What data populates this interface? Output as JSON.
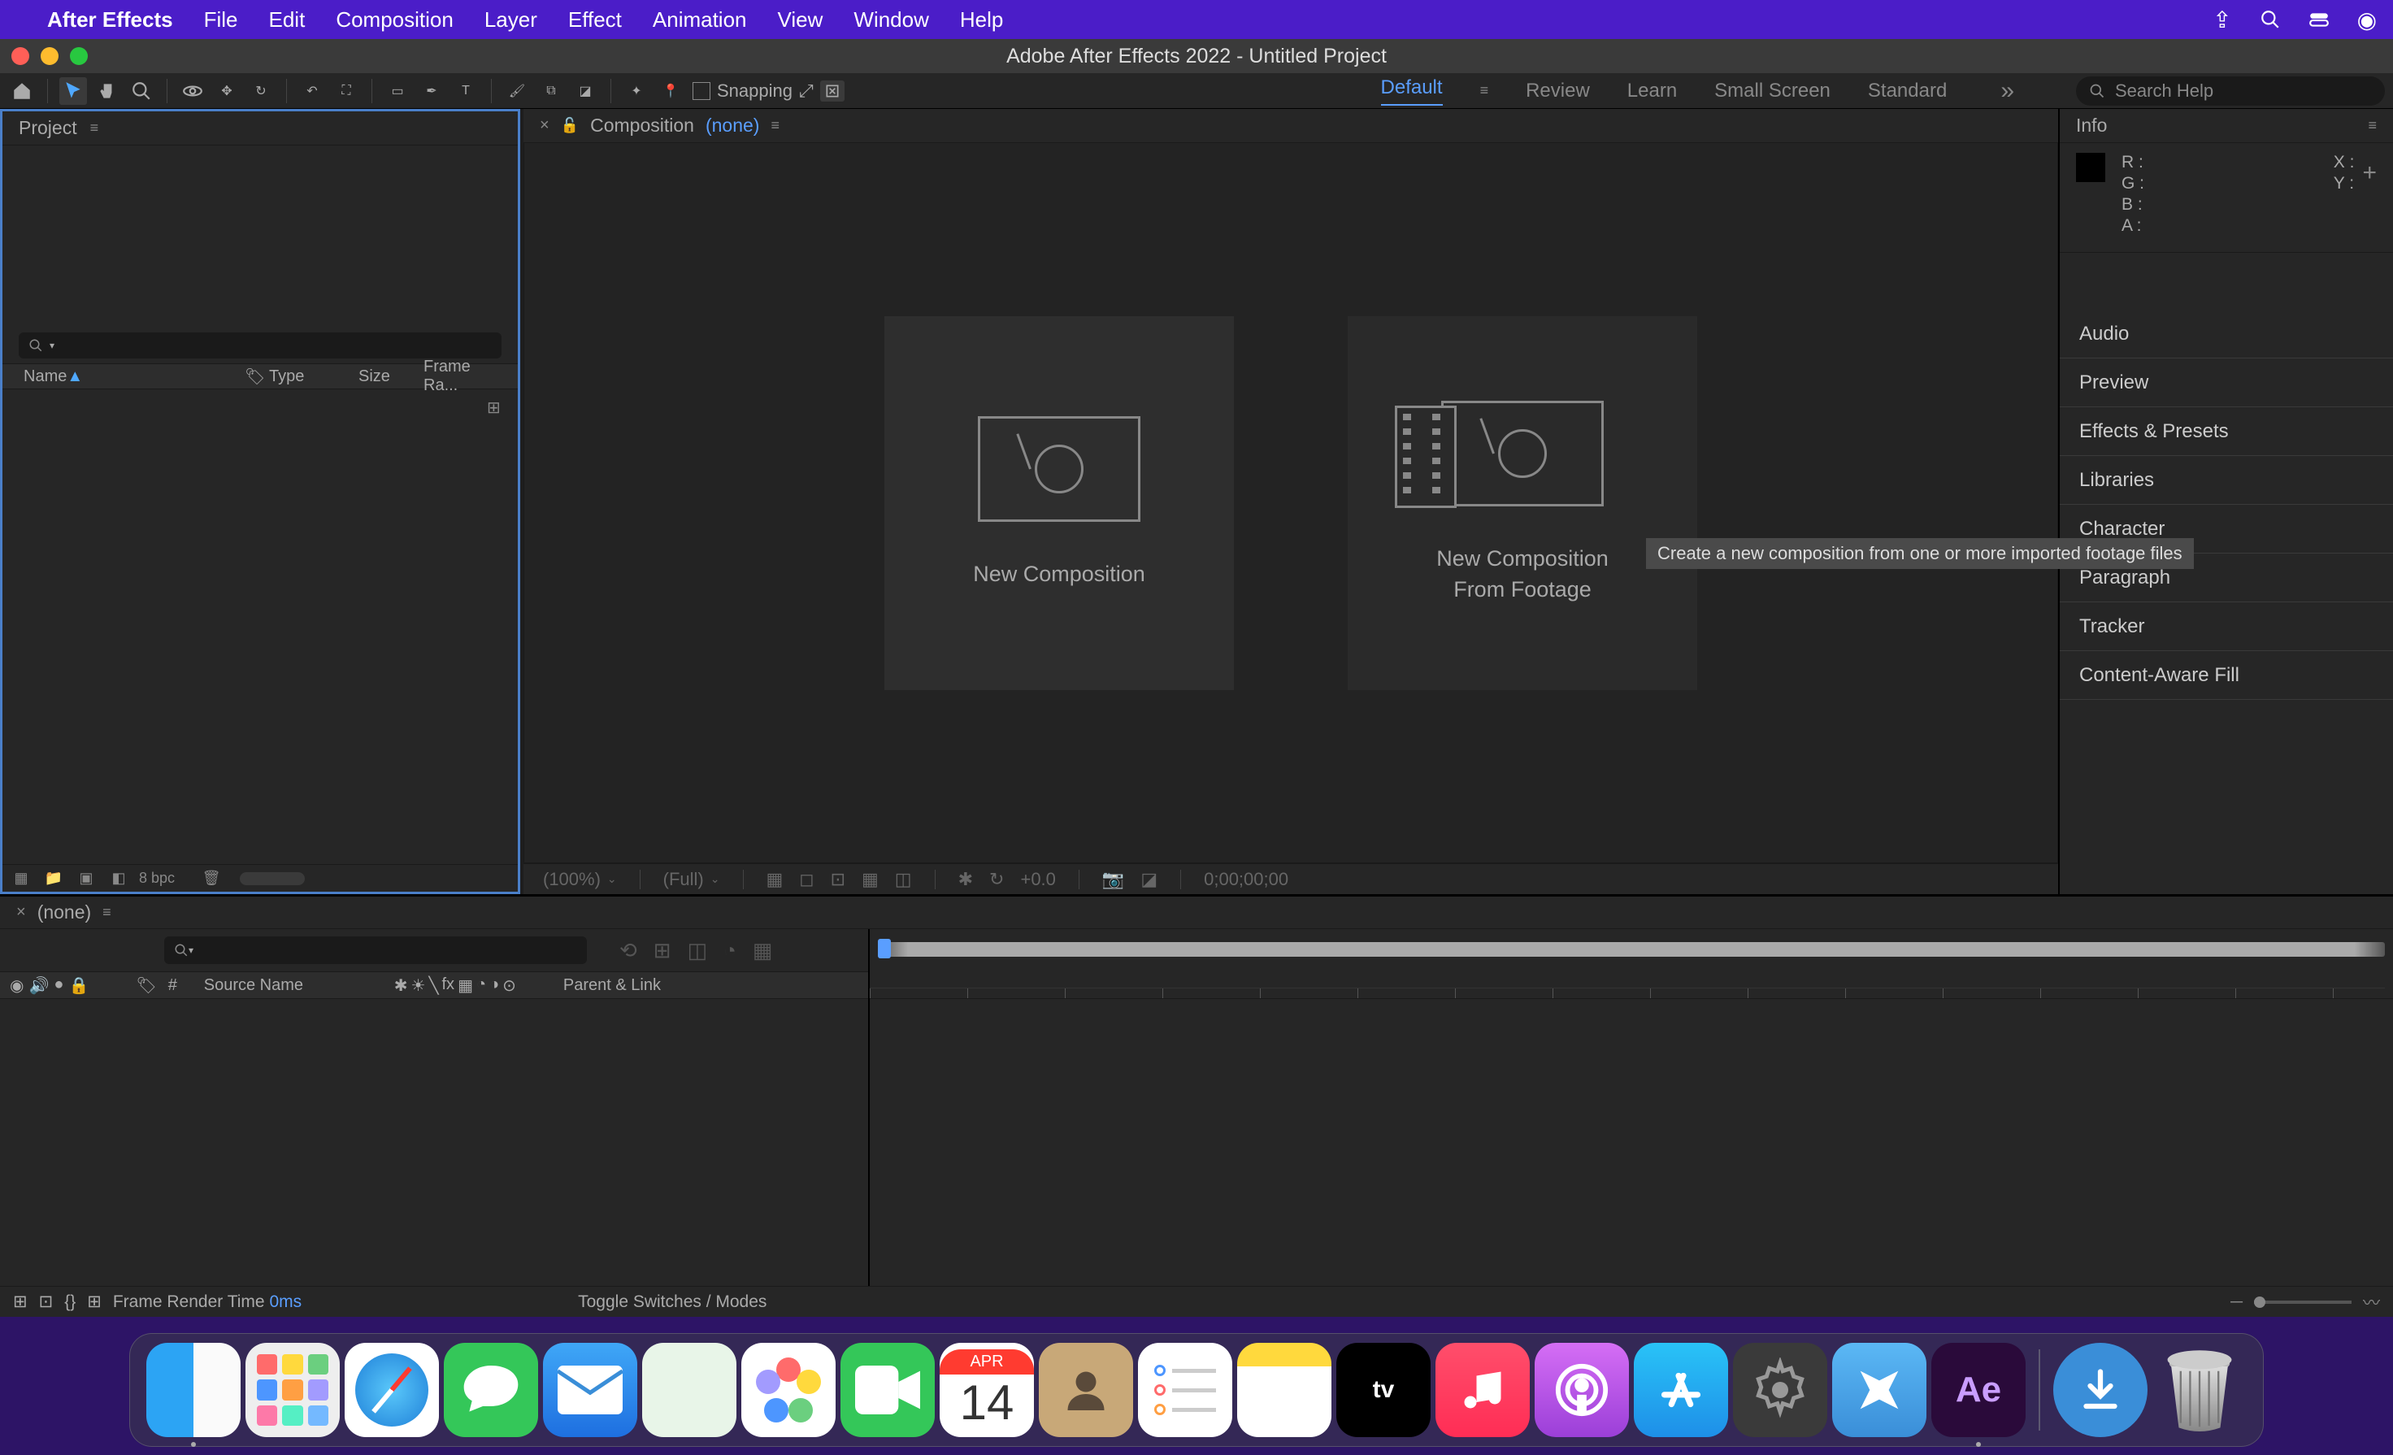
{
  "menubar": {
    "app_name": "After Effects",
    "items": [
      "File",
      "Edit",
      "Composition",
      "Layer",
      "Effect",
      "Animation",
      "View",
      "Window",
      "Help"
    ]
  },
  "window_title": "Adobe After Effects 2022 - Untitled Project",
  "toolbar": {
    "snapping_label": "Snapping",
    "workspaces": [
      "Default",
      "Review",
      "Learn",
      "Small Screen",
      "Standard"
    ],
    "search_placeholder": "Search Help"
  },
  "project_panel": {
    "title": "Project",
    "cols": {
      "name": "Name",
      "type": "Type",
      "size": "Size",
      "framerate": "Frame Ra..."
    },
    "bpc": "8 bpc"
  },
  "comp_viewer": {
    "title": "Composition",
    "none": "(none)",
    "new_comp": "New Composition",
    "new_comp_footage_l1": "New Composition",
    "new_comp_footage_l2": "From Footage",
    "tooltip": "Create a new composition from one or more imported footage files",
    "zoom": "(100%)",
    "res": "(Full)",
    "exposure": "+0.0",
    "timecode": "0;00;00;00"
  },
  "right": {
    "info": "Info",
    "rgba": [
      "R :",
      "G :",
      "B :",
      "A :"
    ],
    "xy": [
      "X :",
      "Y :"
    ],
    "sections": [
      "Audio",
      "Preview",
      "Effects & Presets",
      "Libraries",
      "Character",
      "Paragraph",
      "Tracker",
      "Content-Aware Fill"
    ]
  },
  "timeline": {
    "none": "(none)",
    "source_name": "Source Name",
    "num": "#",
    "parent": "Parent & Link",
    "frame_render": "Frame Render Time",
    "frt_ms": "0ms",
    "toggle": "Toggle Switches / Modes"
  },
  "dock": {
    "cal_month": "APR",
    "cal_day": "14",
    "ae": "Ae"
  }
}
